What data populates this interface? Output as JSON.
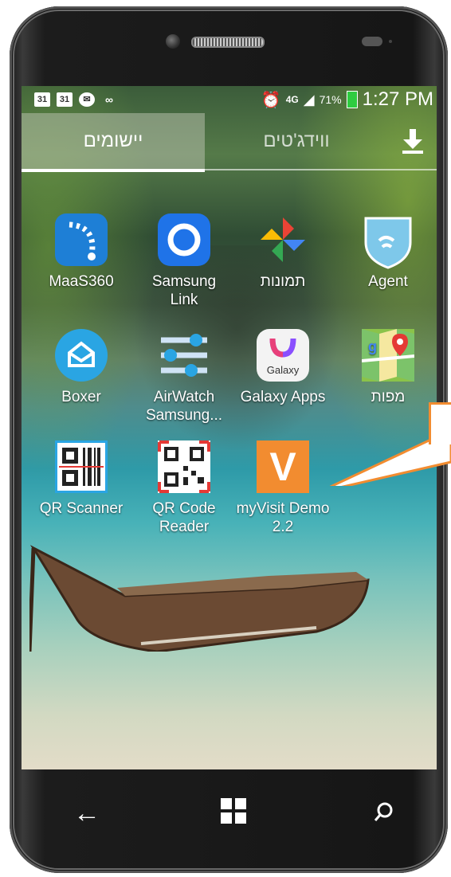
{
  "status_bar": {
    "notification_icons": [
      "calendar-icon",
      "calendar-icon",
      "mail-icon",
      "voicemail-icon"
    ],
    "calendar_day": "31",
    "network": "4G",
    "battery_percent": "71%",
    "time": "1:27 PM"
  },
  "tabs": {
    "apps_label": "יישומים",
    "widgets_label": "ווידג'טים",
    "download_label": "⬇"
  },
  "apps": [
    {
      "label": "MaaS360"
    },
    {
      "label": "Samsung Link"
    },
    {
      "label": "תמונות"
    },
    {
      "label": "Agent"
    },
    {
      "label": "Boxer"
    },
    {
      "label": "AirWatch Samsung..."
    },
    {
      "label": "Galaxy Apps",
      "icon_text": "Galaxy"
    },
    {
      "label": "מפות"
    },
    {
      "label": "QR Scanner"
    },
    {
      "label": "QR Code Reader"
    },
    {
      "label": "myVisit Demo 2.2",
      "icon_text": "V"
    }
  ],
  "nav": {
    "back": "←",
    "home": "⊞",
    "search": "⌕"
  },
  "colors": {
    "callout_border": "#f28c30",
    "myvisit_orange": "#f28c30",
    "maas_blue": "#1e7fd6",
    "samsung_link_blue": "#1f73e8",
    "agent_blue": "#7ec8ea",
    "boxer_blue": "#2aa5e3"
  }
}
